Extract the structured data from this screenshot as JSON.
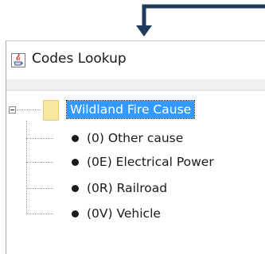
{
  "window": {
    "title": "Codes Lookup",
    "app_icon": "java-cup-icon"
  },
  "tree": {
    "root": {
      "label": "Wildland Fire Cause",
      "expanded": true,
      "selected": true,
      "icon": "folder-icon",
      "expander_icon": "collapse-minus-icon"
    },
    "children": [
      {
        "label": "(0) Other cause",
        "icon": "leaf-dot-icon"
      },
      {
        "label": "(0E) Electrical Power",
        "icon": "leaf-dot-icon"
      },
      {
        "label": "(0R) Railroad",
        "icon": "leaf-dot-icon"
      },
      {
        "label": "(0V) Vehicle",
        "icon": "leaf-dot-icon"
      }
    ]
  },
  "annotation": {
    "arrow_color": "#1f3b5c"
  },
  "colors": {
    "selection": "#3399ff",
    "folder": "#f7e7a0"
  }
}
